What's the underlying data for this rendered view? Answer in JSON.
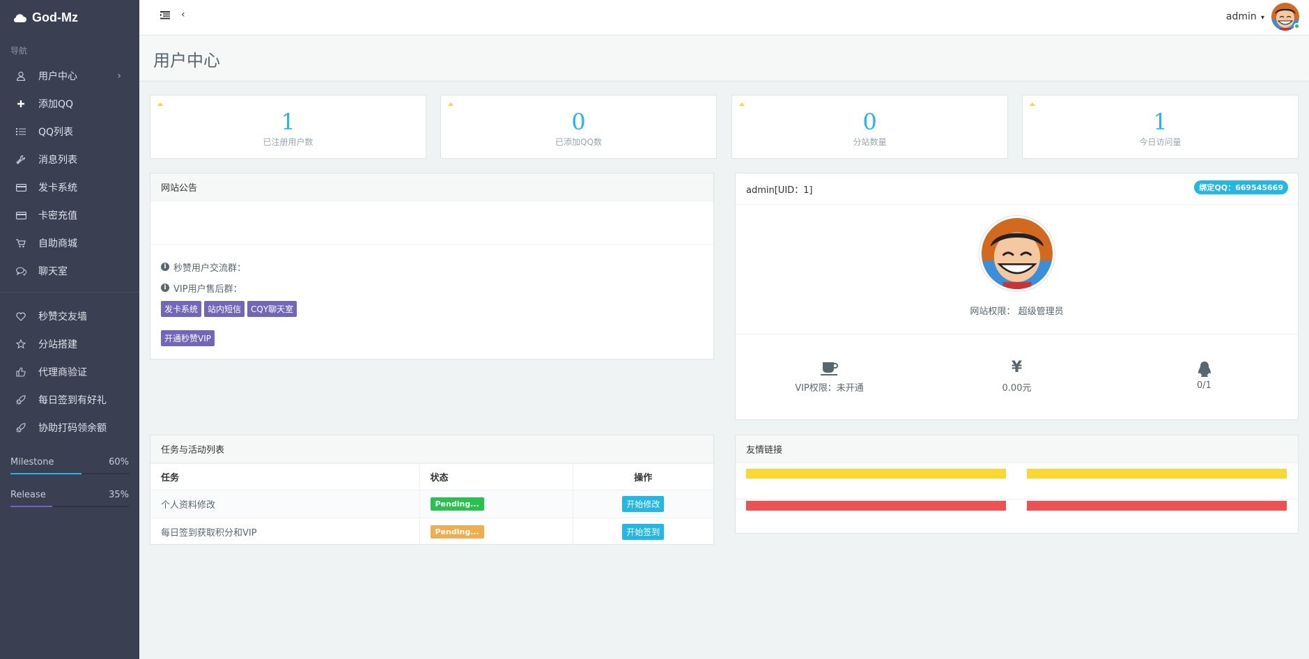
{
  "brand": {
    "name": "God-Mz"
  },
  "nav": {
    "heading": "导航",
    "items": [
      {
        "label": "用户中心",
        "icon": "user-icon"
      },
      {
        "label": "添加QQ",
        "icon": "plus-icon"
      },
      {
        "label": "QQ列表",
        "icon": "list-icon"
      },
      {
        "label": "消息列表",
        "icon": "wrench-icon"
      },
      {
        "label": "发卡系统",
        "icon": "credit-card-icon"
      },
      {
        "label": "卡密充值",
        "icon": "credit-card-icon"
      },
      {
        "label": "自助商城",
        "icon": "cart-icon"
      },
      {
        "label": "聊天室",
        "icon": "chat-icon"
      }
    ],
    "items2": [
      {
        "label": "秒赞交友墙",
        "icon": "heart-icon"
      },
      {
        "label": "分站搭建",
        "icon": "star-icon"
      },
      {
        "label": "代理商验证",
        "icon": "thumbs-up-icon"
      },
      {
        "label": "每日签到有好礼",
        "icon": "rocket-icon"
      },
      {
        "label": "协助打码领余额",
        "icon": "rocket-icon"
      }
    ]
  },
  "progress": [
    {
      "label": "Milestone",
      "value_text": "60%",
      "value": 0.6,
      "color": "#23b7e5"
    },
    {
      "label": "Release",
      "value_text": "35%",
      "value": 0.35,
      "color": "#7266ba"
    }
  ],
  "header": {
    "user": "admin"
  },
  "page": {
    "title": "用户中心"
  },
  "stats": [
    {
      "value": "1",
      "label": "已注册用户数"
    },
    {
      "value": "0",
      "label": "已添加QQ数"
    },
    {
      "value": "0",
      "label": "分站数量"
    },
    {
      "value": "1",
      "label": "今日访问量"
    }
  ],
  "notice": {
    "title": "网站公告",
    "line1": "秒赞用户交流群：",
    "line2": "VIP用户售后群：",
    "buttons": [
      "发卡系统",
      "站内短信",
      "CQY聊天室"
    ],
    "vip_button": "开通秒赞VIP"
  },
  "profile": {
    "title": "admin[UID：1]",
    "bind_qq": "绑定QQ：669545669",
    "role_label": "网站权限：",
    "role": "超级管理员",
    "vip": "VIP权限：未开通",
    "yen_symbol": "¥",
    "balance": "0.00元",
    "qq_count": "0/1"
  },
  "tasks": {
    "title": "任务与活动列表",
    "columns": [
      "任务",
      "状态",
      "操作"
    ],
    "rows": [
      {
        "task": "个人资料修改",
        "status": "Pending...",
        "status_color": "#27c24c",
        "action": "开始修改"
      },
      {
        "task": "每日签到获取积分和VIP",
        "status": "Pending...",
        "status_color": "#f0ad4e",
        "action": "开始签到"
      }
    ]
  },
  "links": {
    "title": "友情链接"
  },
  "colors": {
    "sidebar": "#3a3f51",
    "accent": "#23b7e5",
    "purple": "#7266ba",
    "yellow": "#fad733",
    "red": "#f05050"
  }
}
